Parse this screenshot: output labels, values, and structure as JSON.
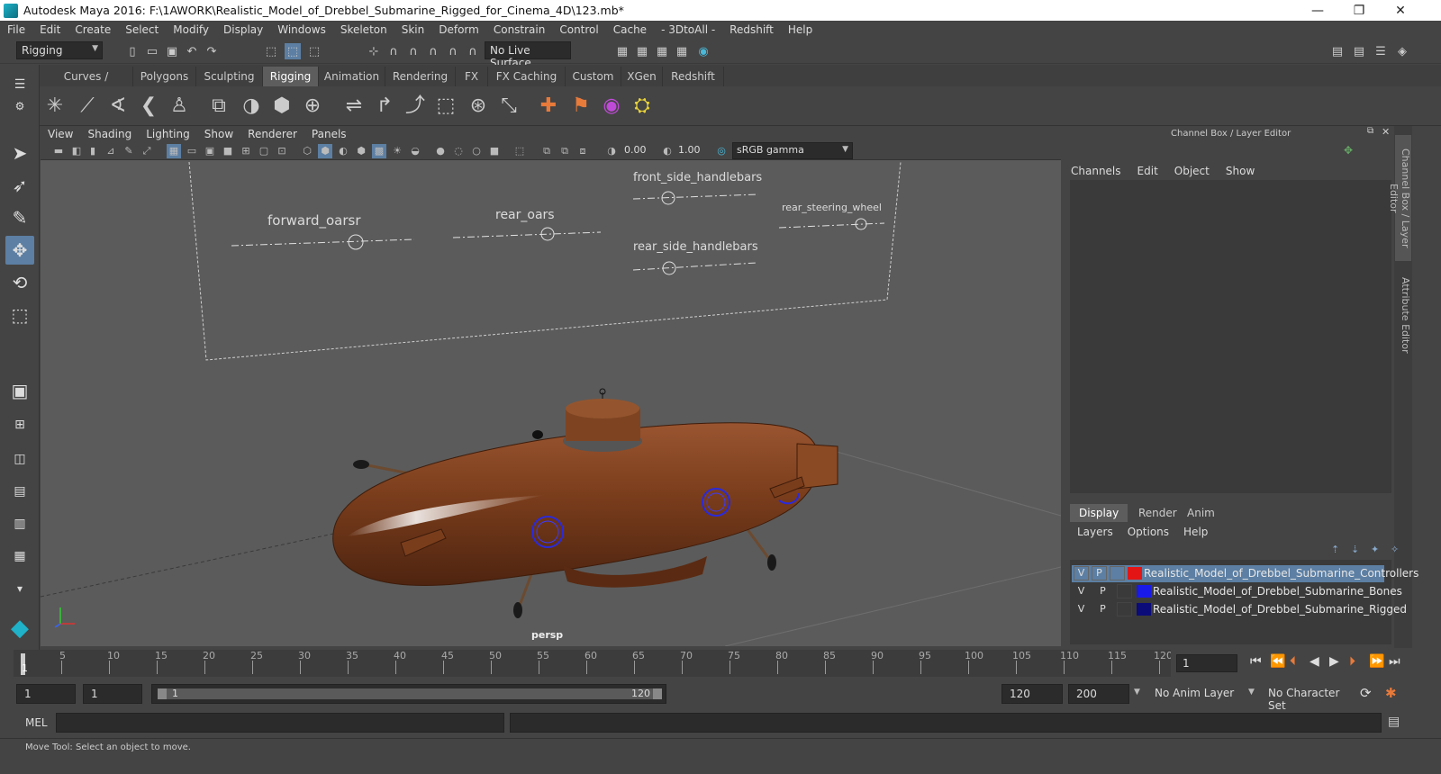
{
  "window": {
    "title": "Autodesk Maya 2016: F:\\1AWORK\\Realistic_Model_of_Drebbel_Submarine_Rigged_for_Cinema_4D\\123.mb*",
    "minimize": "—",
    "maximize": "❐",
    "close": "✕"
  },
  "menubar": [
    "File",
    "Edit",
    "Create",
    "Select",
    "Modify",
    "Display",
    "Windows",
    "Skeleton",
    "Skin",
    "Deform",
    "Constrain",
    "Control",
    "Cache",
    "- 3DtoAll -",
    "Redshift",
    "Help"
  ],
  "statusline": {
    "menuset": "Rigging",
    "live_surface": "No Live Surface"
  },
  "shelf_tabs": [
    "Curves / Surfaces",
    "Polygons",
    "Sculpting",
    "Rigging",
    "Animation",
    "Rendering",
    "FX",
    "FX Caching",
    "Custom",
    "XGen",
    "Redshift"
  ],
  "shelf_active": "Rigging",
  "viewport": {
    "menu": [
      "View",
      "Shading",
      "Lighting",
      "Show",
      "Renderer",
      "Panels"
    ],
    "exposure": "0.00",
    "gamma": "1.00",
    "colorspace": "sRGB gamma",
    "camera_label": "persp",
    "joint_labels": [
      "forward_oarsr",
      "rear_oars",
      "front_side_handlebars",
      "rear_side_handlebars",
      "rear_steering_wheel"
    ]
  },
  "channel_box": {
    "header": "Channel Box / Layer Editor",
    "menu": [
      "Channels",
      "Edit",
      "Object",
      "Show"
    ],
    "side_tab_1": "Channel Box / Layer Editor",
    "side_tab_2": "Attribute Editor"
  },
  "layer_editor": {
    "tabs": [
      "Display",
      "Render",
      "Anim"
    ],
    "active_tab": "Display",
    "menu": [
      "Layers",
      "Options",
      "Help"
    ],
    "layers": [
      {
        "v": "V",
        "p": "P",
        "name": "Realistic_Model_of_Drebbel_Submarine_Controllers",
        "color": "#e41515",
        "selected": true
      },
      {
        "v": "V",
        "p": "P",
        "name": "Realistic_Model_of_Drebbel_Submarine_Bones",
        "color": "#1a1ae8",
        "selected": false
      },
      {
        "v": "V",
        "p": "P",
        "name": "Realistic_Model_of_Drebbel_Submarine_Rigged",
        "color": "#0b0b7a",
        "selected": false
      }
    ]
  },
  "time_slider": {
    "ticks": [
      "5",
      "10",
      "15",
      "20",
      "25",
      "30",
      "35",
      "40",
      "45",
      "50",
      "55",
      "60",
      "65",
      "70",
      "75",
      "80",
      "85",
      "90",
      "95",
      "100",
      "105",
      "110",
      "115",
      "120"
    ],
    "current_marker": "1",
    "current_frame": "1"
  },
  "range": {
    "start": "1",
    "anim_start": "1",
    "range_start_label": "1",
    "range_end_label": "120",
    "range_end": "120",
    "anim_end": "200",
    "anim_layer": "No Anim Layer",
    "character_set": "No Character Set"
  },
  "command_line": {
    "lang": "MEL"
  },
  "help_line": "Move Tool: Select an object to move.",
  "colors": {
    "ui_bg": "#444444",
    "viewport_bg": "#5b5b5b",
    "selection": "#5c7fa3",
    "hull": "#7a3d1c"
  }
}
